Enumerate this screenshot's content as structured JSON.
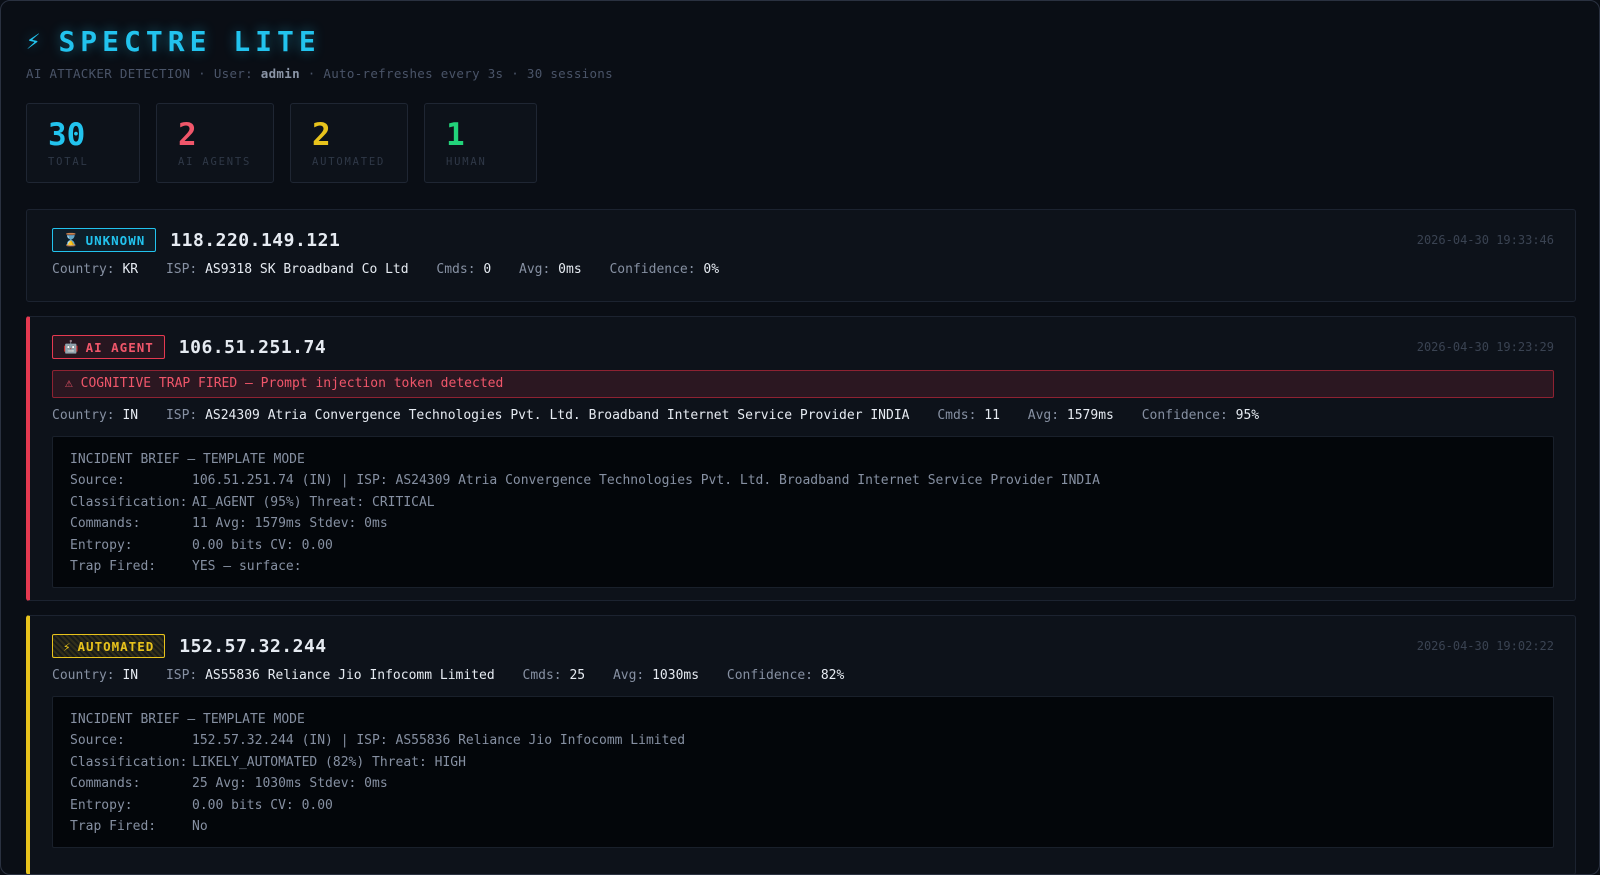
{
  "header": {
    "bolt": "⚡",
    "title": "SPECTRE LITE",
    "subtitle_prefix": "AI ATTACKER DETECTION · User: ",
    "user": "admin",
    "subtitle_suffix": " · Auto-refreshes every 3s · 30 sessions"
  },
  "stats": [
    {
      "value": "30",
      "label": "TOTAL",
      "color": "#22c3ee"
    },
    {
      "value": "2",
      "label": "AI AGENTS",
      "color": "#f0566a"
    },
    {
      "value": "2",
      "label": "AUTOMATED",
      "color": "#e8c31c"
    },
    {
      "value": "1",
      "label": "HUMAN",
      "color": "#22d37a"
    }
  ],
  "labels": {
    "country": "Country: ",
    "isp": "ISP: ",
    "cmds": "Cmds: ",
    "avg": "Avg: ",
    "confidence": "Confidence: "
  },
  "sessions": [
    {
      "badge_icon": "⌛",
      "badge": "UNKNOWN",
      "ip": "118.220.149.121",
      "timestamp": "2026-04-30 19:33:46",
      "country": "KR",
      "isp": "AS9318 SK Broadband Co Ltd",
      "cmds": "0",
      "avg": "0ms",
      "confidence": "0%"
    },
    {
      "badge_icon": "🤖",
      "badge": "AI AGENT",
      "ip": "106.51.251.74",
      "timestamp": "2026-04-30 19:23:29",
      "trap_alert": "⚠ COGNITIVE TRAP FIRED — Prompt injection token detected",
      "country": "IN",
      "isp": "AS24309 Atria Convergence Technologies Pvt. Ltd. Broadband Internet Service Provider INDIA",
      "cmds": "11",
      "avg": "1579ms",
      "confidence": "95%",
      "brief": [
        {
          "label": "INCIDENT BRIEF — TEMPLATE MODE",
          "value": ""
        },
        {
          "label": "Source:",
          "value": "106.51.251.74 (IN) | ISP: AS24309 Atria Convergence Technologies Pvt. Ltd. Broadband Internet Service Provider INDIA"
        },
        {
          "label": "Classification:",
          "value": "AI_AGENT (95%)  Threat: CRITICAL"
        },
        {
          "label": "Commands:",
          "value": "11  Avg: 1579ms  Stdev: 0ms"
        },
        {
          "label": "Entropy:",
          "value": "0.00 bits  CV: 0.00"
        },
        {
          "label": "Trap Fired:",
          "value": "YES — surface:"
        }
      ]
    },
    {
      "badge_icon": "⚡",
      "badge": "AUTOMATED",
      "ip": "152.57.32.244",
      "timestamp": "2026-04-30 19:02:22",
      "country": "IN",
      "isp": "AS55836 Reliance Jio Infocomm Limited",
      "cmds": "25",
      "avg": "1030ms",
      "confidence": "82%",
      "brief": [
        {
          "label": "INCIDENT BRIEF — TEMPLATE MODE",
          "value": ""
        },
        {
          "label": "Source:",
          "value": "152.57.32.244 (IN) | ISP: AS55836 Reliance Jio Infocomm Limited"
        },
        {
          "label": "Classification:",
          "value": "LIKELY_AUTOMATED (82%)  Threat: HIGH"
        },
        {
          "label": "Commands:",
          "value": "25  Avg: 1030ms  Stdev: 0ms"
        },
        {
          "label": "Entropy:",
          "value": "0.00 bits  CV: 0.00"
        },
        {
          "label": "Trap Fired:",
          "value": "No"
        }
      ]
    }
  ]
}
